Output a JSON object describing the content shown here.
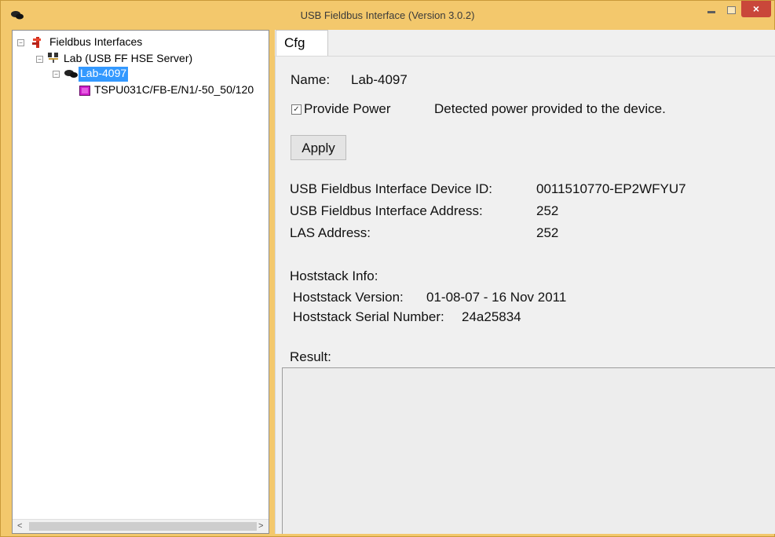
{
  "window": {
    "title": "USB Fieldbus Interface (Version 3.0.2)",
    "icon": "app-icon",
    "controls": {
      "minimize": "minimize",
      "maximize": "maximize",
      "close": "×"
    }
  },
  "tree": {
    "root": {
      "label": "Fieldbus Interfaces",
      "icon": "fieldbus-icon",
      "expanded": true
    },
    "server": {
      "label": "Lab (USB FF HSE Server)",
      "icon": "server-icon",
      "expanded": true
    },
    "interface": {
      "label": "Lab-4097",
      "icon": "interface-icon",
      "expanded": true,
      "selected": true
    },
    "device": {
      "label": "TSPU031C/FB-E/N1/-50_50/120",
      "icon": "device-icon"
    },
    "scroll_left": "<",
    "scroll_right": ">"
  },
  "tabs": [
    {
      "label": "Cfg",
      "active": true
    }
  ],
  "cfg": {
    "name_label": "Name:",
    "name_value": "Lab-4097",
    "provide_power_label": "Provide Power",
    "provide_power_checked": true,
    "check_mark": "✓",
    "power_status": "Detected power provided to the device.",
    "apply_label": "Apply",
    "device_id_label": "USB Fieldbus Interface Device ID:",
    "device_id_value": "0011510770-EP2WFYU7",
    "address_label": "USB Fieldbus Interface Address:",
    "address_value": "252",
    "las_label": "LAS Address:",
    "las_value": "252",
    "hoststack_header": "Hoststack Info:",
    "hoststack_version_label": "Hoststack Version:",
    "hoststack_version_value": "01-08-07 - 16 Nov 2011",
    "hoststack_serial_label": "Hoststack Serial Number:",
    "hoststack_serial_value": "24a25834",
    "result_label": "Result:"
  },
  "colors": {
    "frame": "#f3c86c",
    "selection": "#3399ff",
    "close_button": "#c9473a",
    "device_icon": "#d01ecb"
  }
}
